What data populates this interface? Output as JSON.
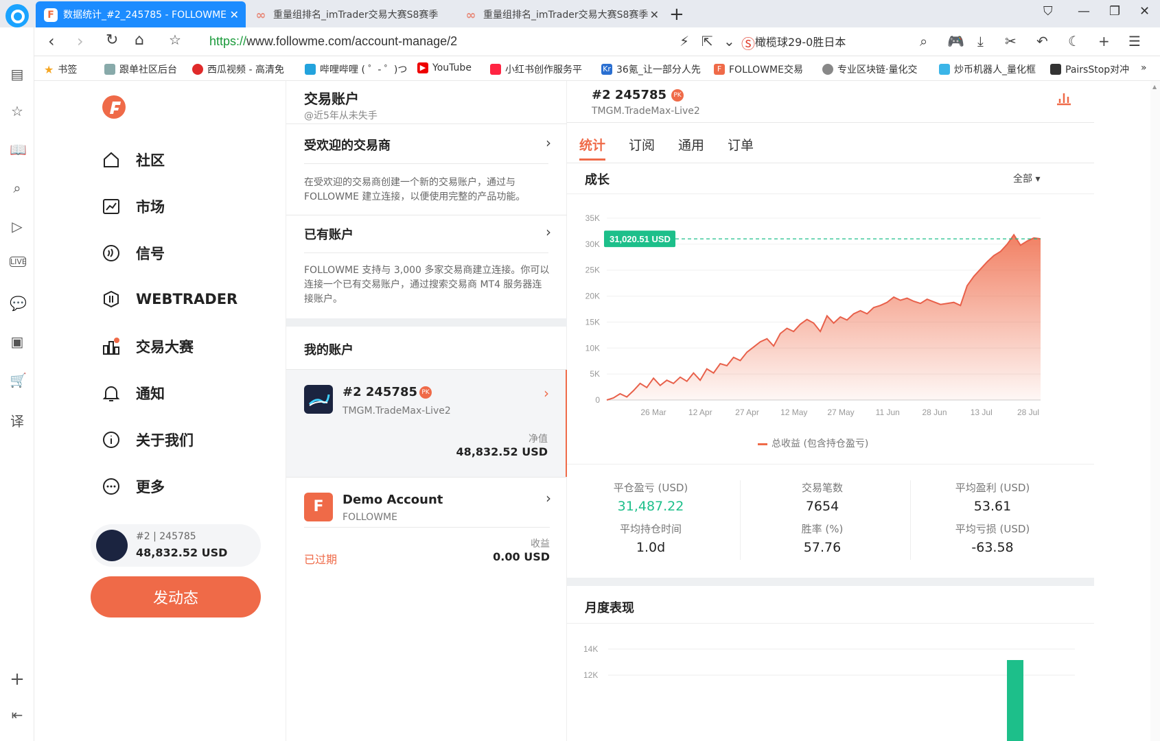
{
  "browser": {
    "tabs": [
      {
        "label": "数据统计_#2_245785 - FOLLOWME",
        "active": true
      },
      {
        "label": "重量组排名_imTrader交易大赛S8赛季",
        "active": false
      },
      {
        "label": "重量组排名_imTrader交易大赛S8赛季",
        "active": false
      }
    ],
    "url_proto": "https://",
    "url_rest": "www.followme.com/account-manage/2",
    "search_text": "橄榄球29-0胜日本",
    "bookmarks": [
      "书签",
      "跟单社区后台",
      "西瓜视频 - 高清免",
      "哔哩哔哩 ( ゜- ゜)つ",
      "YouTube",
      "小红书创作服务平",
      "36氪_让一部分人先",
      "FOLLOWME交易",
      "专业区块链·量化交",
      "炒币机器人_量化框",
      "PairsStop对冲"
    ]
  },
  "nav": {
    "items": [
      {
        "label": "社区",
        "icon": "home-icon"
      },
      {
        "label": "市场",
        "icon": "chart-icon"
      },
      {
        "label": "信号",
        "icon": "signal-icon"
      },
      {
        "label": "WEBTRADER",
        "icon": "webtrader-icon"
      },
      {
        "label": "交易大赛",
        "icon": "trophy-icon"
      },
      {
        "label": "通知",
        "icon": "bell-icon"
      },
      {
        "label": "关于我们",
        "icon": "info-icon"
      },
      {
        "label": "更多",
        "icon": "more-icon"
      }
    ],
    "user_id": "#2 | 245785",
    "user_balance": "48,832.52 USD",
    "post_button": "发动态"
  },
  "middle": {
    "title": "交易账户",
    "subtitle": "@近5年从未失手",
    "popular_title": "受欢迎的交易商",
    "popular_desc": "在受欢迎的交易商创建一个新的交易账户，通过与 FOLLOWME 建立连接，以便使用完整的产品功能。",
    "existing_title": "已有账户",
    "existing_desc": "FOLLOWME 支持与 3,000 多家交易商建立连接。你可以连接一个已有交易账户，通过搜索交易商 MT4 服务器连接账户。",
    "my_accounts_title": "我的账户",
    "account1": {
      "name": "#2  245785",
      "server": "TMGM.TradeMax-Live2",
      "equity_label": "净值",
      "equity": "48,832.52 USD"
    },
    "account2": {
      "name": "Demo Account",
      "server": "FOLLOWME",
      "status": "已过期",
      "profit_label": "收益",
      "profit": "0.00 USD"
    }
  },
  "right": {
    "account_name": "#2  245785",
    "account_server": "TMGM.TradeMax-Live2",
    "tabs": [
      "统计",
      "订阅",
      "通用",
      "订单"
    ],
    "growth_title": "成长",
    "range_select": "全部",
    "current_value_label": "31,020.51 USD",
    "legend": "总收益 (包含持仓盈亏)",
    "stats": [
      {
        "label": "平仓盈亏 (USD)",
        "value": "31,487.22",
        "accent": true
      },
      {
        "label": "交易笔数",
        "value": "7654"
      },
      {
        "label": "平均盈利 (USD)",
        "value": "53.61"
      },
      {
        "label": "平均持仓时间",
        "value": "1.0d"
      },
      {
        "label": "胜率 (%)",
        "value": "57.76"
      },
      {
        "label": "平均亏损 (USD)",
        "value": "-63.58"
      }
    ],
    "monthly_title": "月度表现",
    "monthly_ticks": [
      "14K",
      "12K"
    ]
  },
  "colors": {
    "accent": "#ef6a48",
    "green": "#1dbf8a",
    "blue": "#1c8cff"
  },
  "chart_data": {
    "type": "area",
    "title": "",
    "xlabel": "",
    "ylabel": "",
    "x_ticks": [
      "26 Mar",
      "12 Apr",
      "27 Apr",
      "12 May",
      "27 May",
      "11 Jun",
      "28 Jun",
      "13 Jul",
      "28 Jul"
    ],
    "y_ticks": [
      "0",
      "5K",
      "10K",
      "15K",
      "20K",
      "25K",
      "30K",
      "35K"
    ],
    "ylim": [
      0,
      35000
    ],
    "series": [
      {
        "name": "总收益 (包含持仓盈亏)",
        "values": [
          0,
          400,
          1200,
          600,
          1800,
          3200,
          2400,
          4200,
          2800,
          3800,
          3200,
          4400,
          3600,
          5200,
          3800,
          6000,
          5200,
          7000,
          6600,
          8200,
          7600,
          9200,
          10200,
          11200,
          11800,
          10400,
          12800,
          13800,
          13200,
          14600,
          15500,
          14800,
          13200,
          16200,
          14800,
          16000,
          15400,
          16600,
          17200,
          16600,
          17800,
          18200,
          18800,
          19800,
          19200,
          19600,
          19000,
          18600,
          19400,
          18900,
          18400,
          18600,
          18800,
          18200,
          22000,
          23800,
          25200,
          26600,
          27800,
          28600,
          30000,
          31800,
          29800,
          30600,
          31200,
          31020
        ]
      }
    ],
    "reference_line": 31020.51,
    "grid": true,
    "legend_position": "bottom"
  }
}
